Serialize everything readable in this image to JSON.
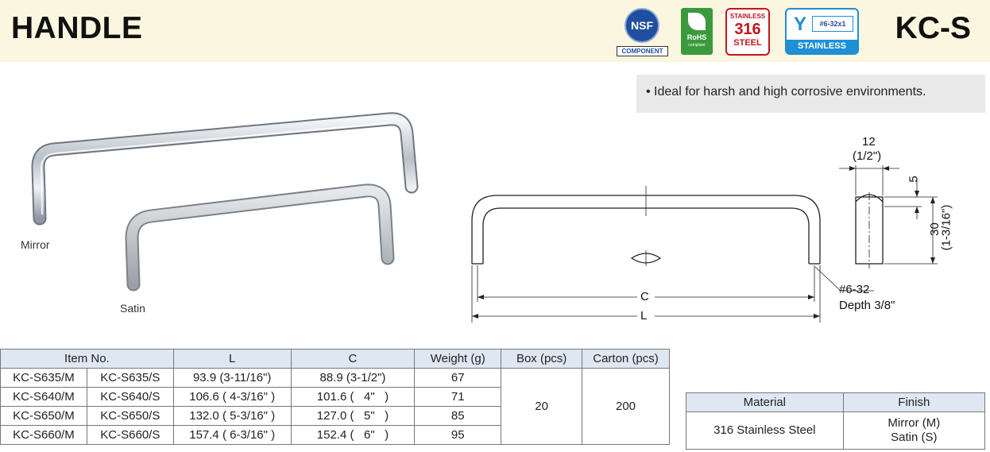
{
  "header": {
    "title": "HANDLE",
    "code": "KC-S"
  },
  "badges": {
    "nsf": {
      "mark": "NSF",
      "label": "COMPONENT"
    },
    "rohs": {
      "mark": "RoHS",
      "sub": "compliant"
    },
    "stainless316": {
      "top": "STAINLESS",
      "grade": "316",
      "bottom": "STEEL"
    },
    "screw": {
      "spec": "#6-32x1",
      "material": "STAINLESS"
    },
    "colors": {
      "nsf": "#1f4f9e",
      "rohs": "#3a9a3d",
      "stainless": "#c4161c",
      "screw": "#1f8fd6"
    }
  },
  "feature": "• Ideal for harsh and high corrosive environments.",
  "photos": {
    "mirror": "Mirror",
    "satin": "Satin"
  },
  "drawing": {
    "c_label": "C",
    "l_label": "L",
    "thread": "#6-32",
    "depth": "Depth 3/8\"",
    "width_mm": "12",
    "width_in": "(1/2\")",
    "top_dim": "5",
    "height": "30",
    "height_in": "(1-3/16\")"
  },
  "spec_table": {
    "headers": [
      "Item No.",
      "L",
      "C",
      "Weight (g)",
      "Box (pcs)",
      "Carton (pcs)"
    ],
    "rows": [
      {
        "mirror": "KC-S635/M",
        "satin": "KC-S635/S",
        "L": "93.9 (3-11/16\")",
        "C": "88.9 (3-1/2\")",
        "weight": "67"
      },
      {
        "mirror": "KC-S640/M",
        "satin": "KC-S640/S",
        "L": "106.6 ( 4-3/16\" )",
        "C": "101.6 (   4\"   )",
        "weight": "71"
      },
      {
        "mirror": "KC-S650/M",
        "satin": "KC-S650/S",
        "L": "132.0 ( 5-3/16\" )",
        "C": "127.0 (   5\"   )",
        "weight": "85"
      },
      {
        "mirror": "KC-S660/M",
        "satin": "KC-S660/S",
        "L": "157.4 ( 6-3/16\" )",
        "C": "152.4 (   6\"   )",
        "weight": "95"
      }
    ],
    "box": "20",
    "carton": "200"
  },
  "material_table": {
    "headers": [
      "Material",
      "Finish"
    ],
    "material": "316 Stainless Steel",
    "finish_1": "Mirror (M)",
    "finish_2": "Satin (S)"
  }
}
